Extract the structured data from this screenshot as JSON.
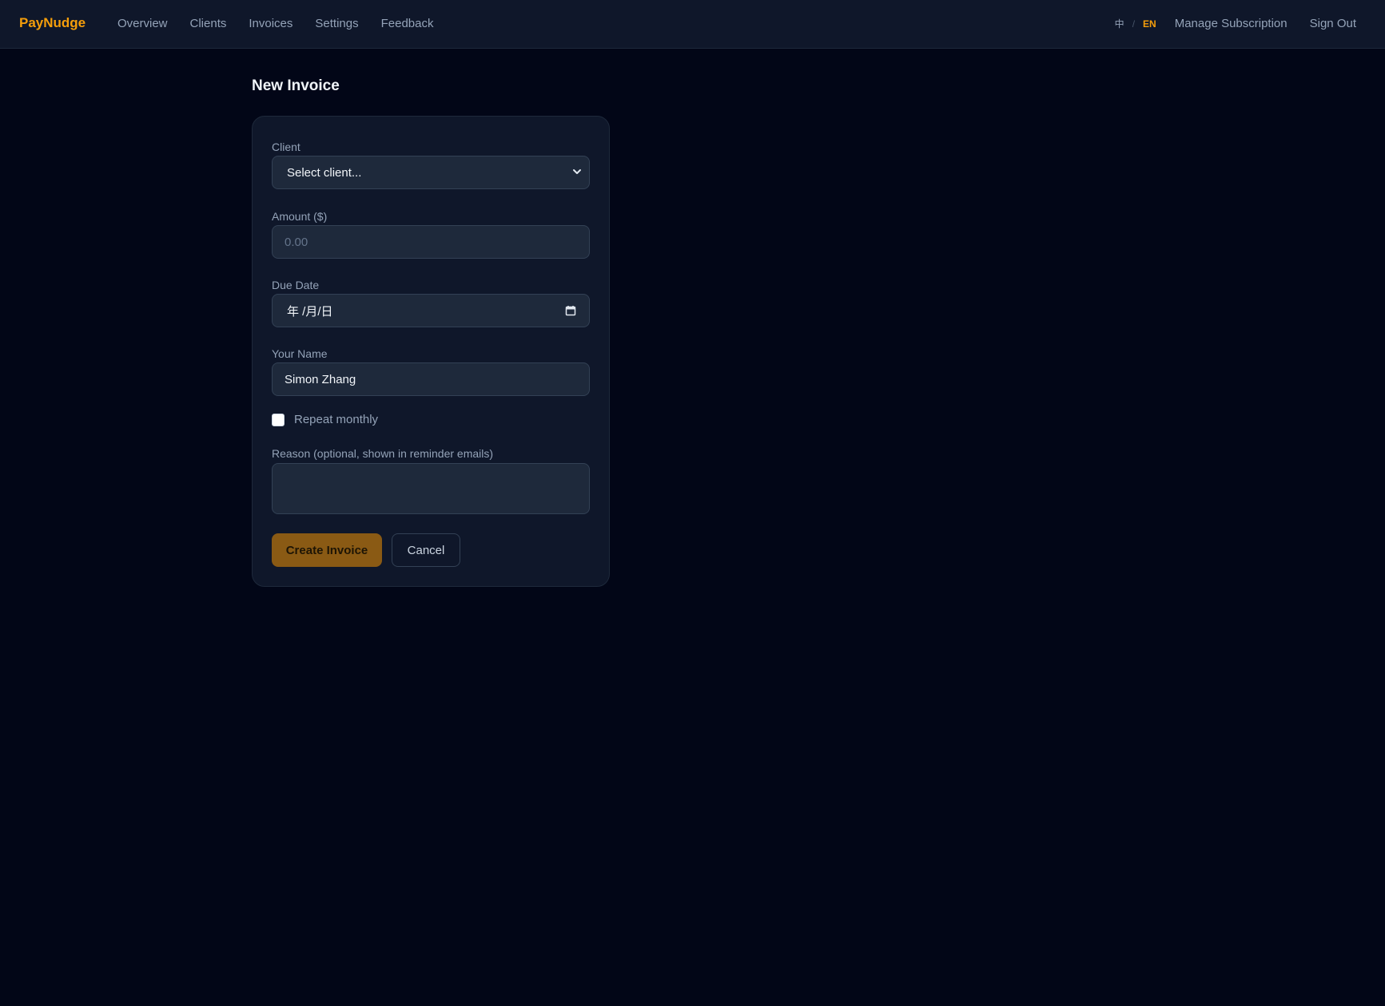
{
  "header": {
    "brand": "PayNudge",
    "nav": [
      "Overview",
      "Clients",
      "Invoices",
      "Settings",
      "Feedback"
    ],
    "lang_zh": "中",
    "lang_sep": "/",
    "lang_en": "EN",
    "manage_subscription": "Manage Subscription",
    "sign_out": "Sign Out"
  },
  "page": {
    "title": "New Invoice"
  },
  "form": {
    "client_label": "Client",
    "client_value": "Select client...",
    "amount_label": "Amount ($)",
    "amount_placeholder": "0.00",
    "due_date_label": "Due Date",
    "due_date_value": "年 /月/日",
    "name_label": "Your Name",
    "name_value": "Simon Zhang",
    "repeat_label": "Repeat monthly",
    "repeat_checked": false,
    "reason_label": "Reason (optional, shown in reminder emails)",
    "reason_value": "",
    "create_button": "Create Invoice",
    "cancel_button": "Cancel"
  },
  "colors": {
    "background": "#020617",
    "header": "#0f172a",
    "card": "#0f172a",
    "input": "#1e293b",
    "accent": "#f59e0b",
    "primary_button": "#8a5a14"
  },
  "icons": {
    "select": "chevron-down-icon",
    "date": "calendar-icon"
  }
}
